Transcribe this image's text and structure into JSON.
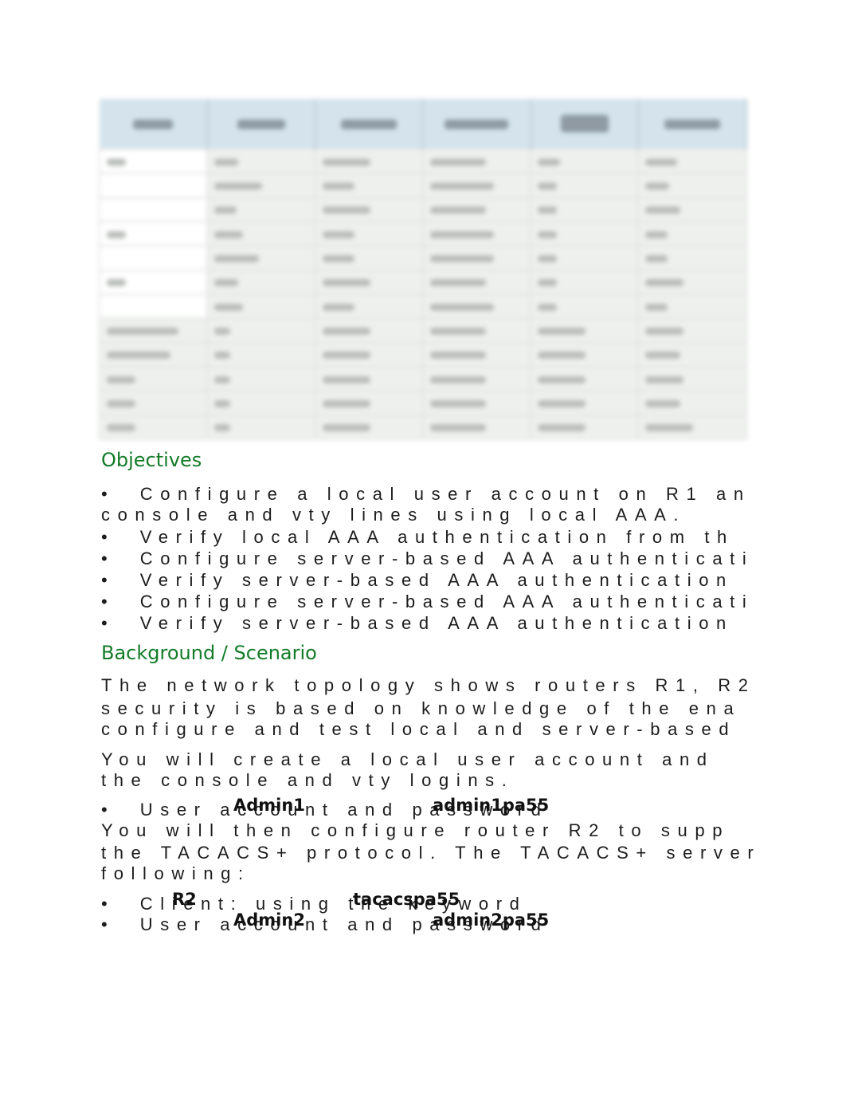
{
  "table": {
    "blurred": true,
    "header_color": "#d4e3ec",
    "columns": 6,
    "rows": 12
  },
  "objectives": {
    "heading": "Objectives",
    "lines": [
      "•  Configure a local user account on R1 an",
      "console and vty lines using local AAA.",
      "•  Verify local AAA authentication from th",
      "•  Configure server-based AAA authenticati",
      "•  Verify server-based AAA authentication",
      "•  Configure server-based AAA authenticati",
      "•  Verify server-based AAA authentication"
    ]
  },
  "background": {
    "heading": "Background / Scenario",
    "para1": [
      "The network topology shows routers R1, R2",
      "security is based on knowledge of the ena",
      "configure and test local and server-based"
    ],
    "para2": [
      "You will create a local user account and",
      "the console and vty logins."
    ],
    "bullet1": "•  User account and password",
    "bullet1_user": "Admin1",
    "bullet1_pass": "admin1pa55",
    "para3": [
      "You will then configure router R2 to supp",
      "the TACACS+ protocol. The TACACS+ server",
      "following:"
    ],
    "bullet2": "•  Client: using the keyword",
    "bullet2_client": "R2",
    "bullet2_key": "tacacspa55",
    "bullet3": "•  User account and password",
    "bullet3_user": "Admin2",
    "bullet3_pass": "admin2pa55"
  },
  "colors": {
    "heading": "#137b27"
  }
}
